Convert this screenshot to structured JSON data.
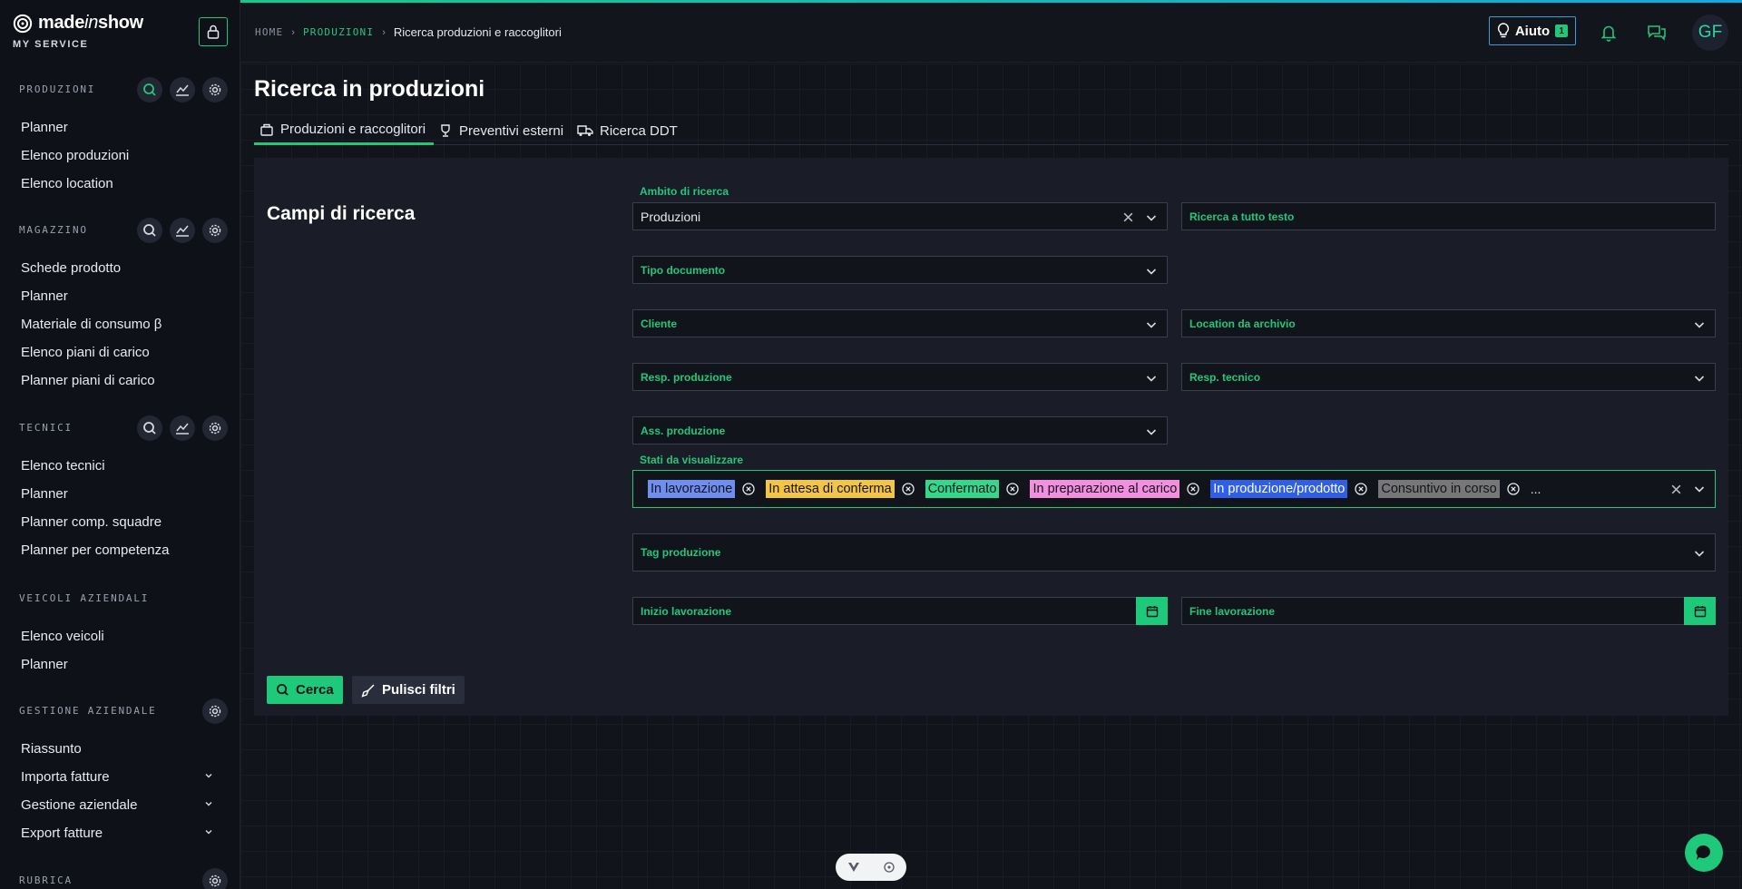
{
  "brand": {
    "name_pre": "made",
    "name_in": "in",
    "name_post": "show",
    "subtitle": "MY SERVICE"
  },
  "sidebar": {
    "sections": [
      {
        "title": "PRODUZIONI",
        "items": [
          "Planner",
          "Elenco produzioni",
          "Elenco location"
        ]
      },
      {
        "title": "MAGAZZINO",
        "items": [
          "Schede prodotto",
          "Planner",
          "Materiale di consumo β",
          "Elenco piani di carico",
          "Planner piani di carico"
        ]
      },
      {
        "title": "TECNICI",
        "items": [
          "Elenco tecnici",
          "Planner",
          "Planner comp. squadre",
          "Planner per competenza"
        ]
      },
      {
        "title": "VEICOLI AZIENDALI",
        "items": [
          "Elenco veicoli",
          "Planner"
        ]
      },
      {
        "title": "GESTIONE AZIENDALE",
        "items": [
          "Riassunto",
          "Importa fatture",
          "Gestione aziendale",
          "Export fatture"
        ]
      },
      {
        "title": "RUBRICA",
        "items": []
      }
    ]
  },
  "topbar": {
    "breadcrumb": {
      "home": "HOME",
      "section": "PRODUZIONI",
      "current": "Ricerca produzioni e raccoglitori"
    },
    "help_label": "Aiuto",
    "help_badge": "1",
    "avatar_initials": "GF"
  },
  "page": {
    "title": "Ricerca in produzioni",
    "tabs": [
      "Produzioni e raccoglitori",
      "Preventivi esterni",
      "Ricerca DDT"
    ]
  },
  "form": {
    "panel_title": "Campi di ricerca",
    "ambito_label": "Ambito di ricerca",
    "ambito_value": "Produzioni",
    "fulltext_placeholder": "Ricerca a tutto testo",
    "tipo_documento": "Tipo documento",
    "cliente": "Cliente",
    "location": "Location da archivio",
    "resp_produzione": "Resp. produzione",
    "resp_tecnico": "Resp. tecnico",
    "ass_produzione": "Ass. produzione",
    "stati_label": "Stati da visualizzare",
    "stati": [
      {
        "label": "In lavorazione",
        "color": "#6f8ff0"
      },
      {
        "label": "In attesa di conferma",
        "color": "#f4c542"
      },
      {
        "label": "Confermato",
        "color": "#33d98a"
      },
      {
        "label": "In preparazione al carico",
        "color": "#f48fe0"
      },
      {
        "label": "In produzione/prodotto",
        "color": "#2f5ee8"
      },
      {
        "label": "Consuntivo in corso",
        "color": "#777777"
      }
    ],
    "stati_more": "...",
    "tag_produzione": "Tag produzione",
    "inizio_lavorazione": "Inizio lavorazione",
    "fine_lavorazione": "Fine lavorazione",
    "search_button": "Cerca",
    "clear_button": "Pulisci filtri"
  },
  "colors": {
    "accent": "#1ec97a",
    "background": "#12141c",
    "panel": "#1a1d27"
  }
}
